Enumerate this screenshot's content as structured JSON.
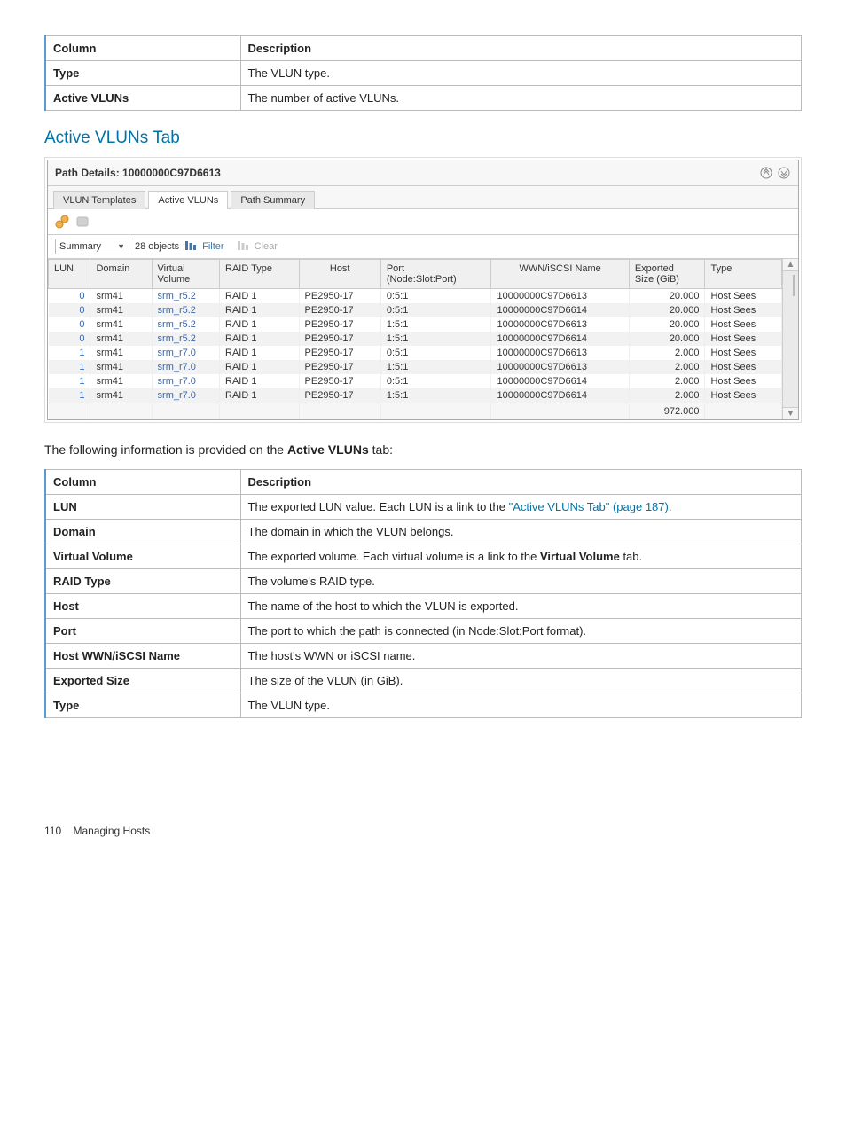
{
  "topTable": {
    "header": {
      "col": "Column",
      "desc": "Description"
    },
    "rows": [
      {
        "col": "Type",
        "desc": "The VLUN type."
      },
      {
        "col": "Active VLUNs",
        "desc": "The number of active VLUNs."
      }
    ]
  },
  "sectionTitle": "Active VLUNs Tab",
  "panel": {
    "title": "Path Details: 10000000C97D6613",
    "tabs": {
      "t0": "VLUN Templates",
      "t1": "Active VLUNs",
      "t2": "Path Summary"
    },
    "filter": {
      "combo": "Summary",
      "count": "28 objects",
      "filter": "Filter",
      "clear": "Clear"
    },
    "grid": {
      "cols": {
        "lun": "LUN",
        "domain": "Domain",
        "vv": "Virtual\nVolume",
        "raid": "RAID Type",
        "host": "Host",
        "port": "Port\n(Node:Slot:Port)",
        "wwn": "WWN/iSCSI Name",
        "size": "Exported\nSize (GiB)",
        "type": "Type"
      },
      "rows": [
        {
          "lun": "0",
          "domain": "srm41",
          "vv": "srm_r5.2",
          "raid": "RAID 1",
          "host": "PE2950-17",
          "port": "0:5:1",
          "wwn": "10000000C97D6613",
          "size": "20.000",
          "type": "Host Sees"
        },
        {
          "lun": "0",
          "domain": "srm41",
          "vv": "srm_r5.2",
          "raid": "RAID 1",
          "host": "PE2950-17",
          "port": "0:5:1",
          "wwn": "10000000C97D6614",
          "size": "20.000",
          "type": "Host Sees"
        },
        {
          "lun": "0",
          "domain": "srm41",
          "vv": "srm_r5.2",
          "raid": "RAID 1",
          "host": "PE2950-17",
          "port": "1:5:1",
          "wwn": "10000000C97D6613",
          "size": "20.000",
          "type": "Host Sees"
        },
        {
          "lun": "0",
          "domain": "srm41",
          "vv": "srm_r5.2",
          "raid": "RAID 1",
          "host": "PE2950-17",
          "port": "1:5:1",
          "wwn": "10000000C97D6614",
          "size": "20.000",
          "type": "Host Sees"
        },
        {
          "lun": "1",
          "domain": "srm41",
          "vv": "srm_r7.0",
          "raid": "RAID 1",
          "host": "PE2950-17",
          "port": "0:5:1",
          "wwn": "10000000C97D6613",
          "size": "2.000",
          "type": "Host Sees"
        },
        {
          "lun": "1",
          "domain": "srm41",
          "vv": "srm_r7.0",
          "raid": "RAID 1",
          "host": "PE2950-17",
          "port": "1:5:1",
          "wwn": "10000000C97D6613",
          "size": "2.000",
          "type": "Host Sees"
        },
        {
          "lun": "1",
          "domain": "srm41",
          "vv": "srm_r7.0",
          "raid": "RAID 1",
          "host": "PE2950-17",
          "port": "0:5:1",
          "wwn": "10000000C97D6614",
          "size": "2.000",
          "type": "Host Sees"
        },
        {
          "lun": "1",
          "domain": "srm41",
          "vv": "srm_r7.0",
          "raid": "RAID 1",
          "host": "PE2950-17",
          "port": "1:5:1",
          "wwn": "10000000C97D6614",
          "size": "2.000",
          "type": "Host Sees"
        }
      ],
      "footerTotal": "972.000"
    }
  },
  "intro": {
    "pre": "The following information is provided on the ",
    "b": "Active VLUNs",
    "post": " tab:"
  },
  "bottomTable": {
    "header": {
      "col": "Column",
      "desc": "Description"
    },
    "rows": [
      {
        "col": "LUN",
        "desc_pre": "The exported LUN value. Each LUN is a link to the ",
        "link": "\"Active VLUNs Tab\" (page 187)",
        "desc_post": "."
      },
      {
        "col": "Domain",
        "desc": "The domain in which the VLUN belongs."
      },
      {
        "col": "Virtual Volume",
        "desc_pre": "The exported volume. Each virtual volume is a link to the ",
        "bold": "Virtual Volume",
        "desc_post": " tab."
      },
      {
        "col": "RAID Type",
        "desc": "The volume's RAID type."
      },
      {
        "col": "Host",
        "desc": "The name of the host to which the VLUN is exported."
      },
      {
        "col": "Port",
        "desc": "The port to which the path is connected (in Node:Slot:Port format)."
      },
      {
        "col": "Host WWN/iSCSI Name",
        "desc": "The host's WWN or iSCSI name."
      },
      {
        "col": "Exported Size",
        "desc": "The size of the VLUN (in GiB)."
      },
      {
        "col": "Type",
        "desc": "The VLUN type."
      }
    ]
  },
  "footer": {
    "page": "110",
    "title": "Managing Hosts"
  }
}
